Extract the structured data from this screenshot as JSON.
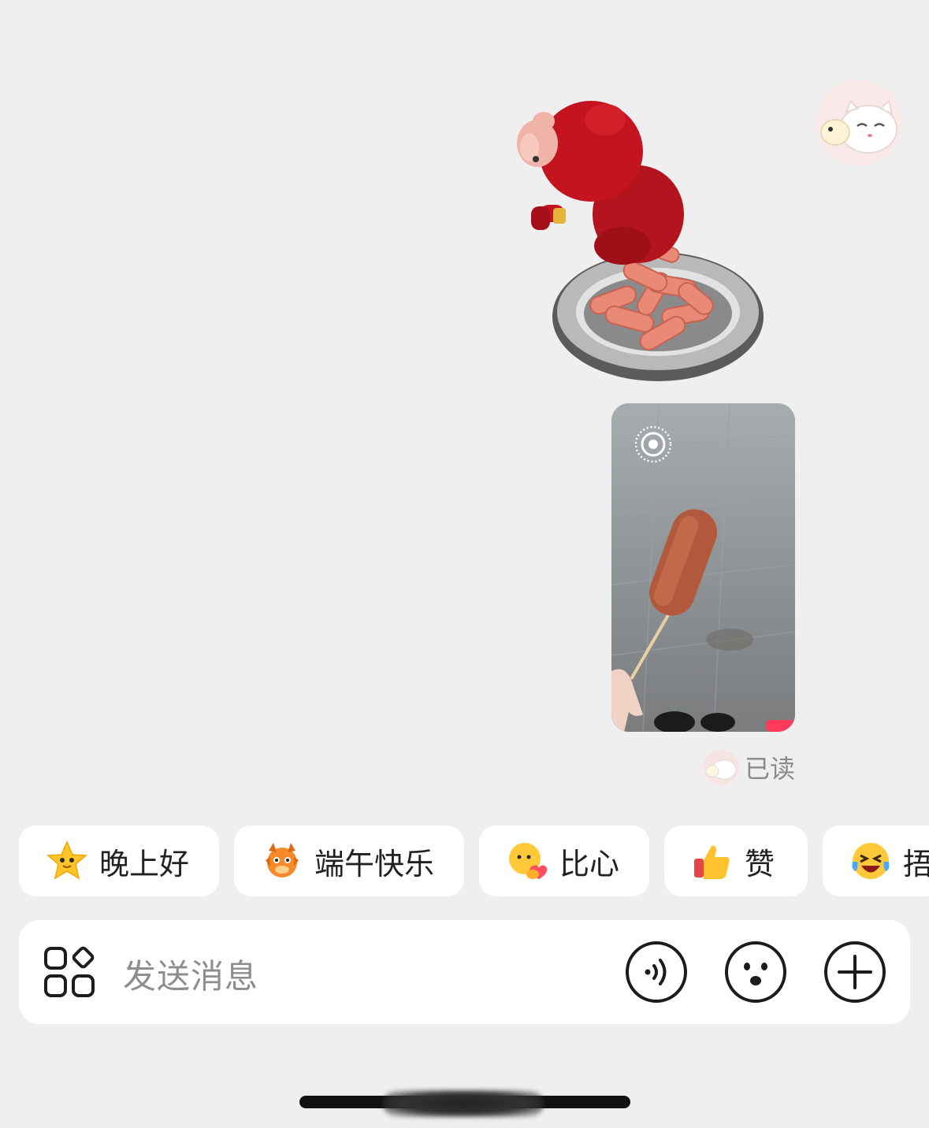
{
  "chat": {
    "contact_avatar_icon": "cat-avatar",
    "messages": [
      {
        "type": "sticker",
        "icon": "red-pig-with-sausage-plate-sticker"
      },
      {
        "type": "video",
        "icon": "live-photo-icon",
        "subject": "sausage-on-stick"
      }
    ],
    "read_status": "已读"
  },
  "quick_replies": [
    {
      "icon": "star-face-emoji",
      "label": "晚上好"
    },
    {
      "icon": "dragon-emoji",
      "label": "端午快乐"
    },
    {
      "icon": "heart-hands-emoji",
      "label": "比心"
    },
    {
      "icon": "thumbs-up-emoji",
      "label": "赞"
    },
    {
      "icon": "laughing-tears-emoji",
      "label": "捂"
    }
  ],
  "input": {
    "placeholder": "发送消息",
    "left_icon": "apps-grid-icon",
    "buttons": [
      "voice-icon",
      "emoji-face-icon",
      "plus-icon"
    ]
  },
  "colors": {
    "background": "#efefef",
    "card": "#ffffff",
    "text": "#222222",
    "muted": "#8e8e8e",
    "icon_stroke": "#1c1c1c"
  }
}
